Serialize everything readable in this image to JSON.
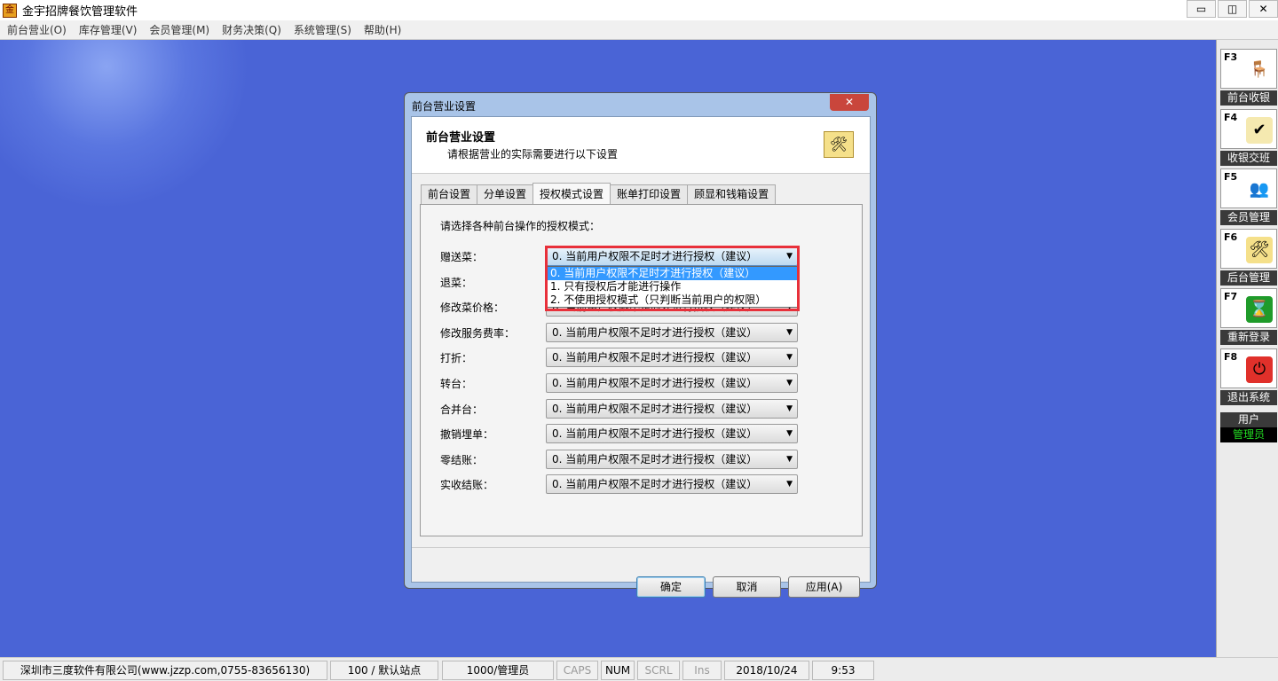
{
  "app": {
    "title": "金宇招牌餐饮管理软件",
    "icon_text": "金"
  },
  "window_controls": {
    "minimize": "▭",
    "restore": "◫",
    "close": "✕"
  },
  "menu": [
    "前台营业(O)",
    "库存管理(V)",
    "会员管理(M)",
    "财务决策(Q)",
    "系统管理(S)",
    "帮助(H)"
  ],
  "sidebar": {
    "items": [
      {
        "key": "F3",
        "label": "前台收银",
        "icon": "dining-table-icon",
        "glyph": "🪑",
        "color": "#ffffff"
      },
      {
        "key": "F4",
        "label": "收银交班",
        "icon": "clipboard-check-icon",
        "glyph": "✔",
        "color": "#f5e9b0"
      },
      {
        "key": "F5",
        "label": "会员管理",
        "icon": "users-icon",
        "glyph": "👥",
        "color": "#ffffff"
      },
      {
        "key": "F6",
        "label": "后台管理",
        "icon": "folder-tools-icon",
        "glyph": "🛠",
        "color": "#f5e08a"
      },
      {
        "key": "F7",
        "label": "重新登录",
        "icon": "hourglass-icon",
        "glyph": "⌛",
        "color": "#1f9b2a"
      },
      {
        "key": "F8",
        "label": "退出系统",
        "icon": "power-icon",
        "glyph": "⏻",
        "color": "#e0302a"
      }
    ],
    "user_label": "用户",
    "user_name": "管理员"
  },
  "dialog": {
    "title": "前台营业设置",
    "close": "✕",
    "header_title": "前台营业设置",
    "header_subtitle": "请根据营业的实际需要进行以下设置",
    "tabs": [
      "前台设置",
      "分单设置",
      "授权模式设置",
      "账单打印设置",
      "顾显和钱箱设置"
    ],
    "active_tab": 2,
    "prompt": "请选择各种前台操作的授权模式：",
    "rows": [
      {
        "label": "赠送菜：",
        "value": "0. 当前用户权限不足时才进行授权（建议）"
      },
      {
        "label": "退菜：",
        "value": "0. 当前用户权限不足时才进行授权（建议）"
      },
      {
        "label": "修改菜价格：",
        "value": "0. 当前用户权限不足时才进行授权（建议）"
      },
      {
        "label": "修改服务费率：",
        "value": "0. 当前用户权限不足时才进行授权（建议）"
      },
      {
        "label": "打折：",
        "value": "0. 当前用户权限不足时才进行授权（建议）"
      },
      {
        "label": "转台：",
        "value": "0. 当前用户权限不足时才进行授权（建议）"
      },
      {
        "label": "合并台：",
        "value": "0. 当前用户权限不足时才进行授权（建议）"
      },
      {
        "label": "撤销埋单：",
        "value": "0. 当前用户权限不足时才进行授权（建议）"
      },
      {
        "label": "零结账：",
        "value": "0. 当前用户权限不足时才进行授权（建议）"
      },
      {
        "label": "实收结账：",
        "value": "0. 当前用户权限不足时才进行授权（建议）"
      }
    ],
    "dropdown_options": [
      "0. 当前用户权限不足时才进行授权（建议）",
      "1. 只有授权后才能进行操作",
      "2. 不使用授权模式（只判断当前用户的权限）"
    ],
    "dropdown_selected": 0,
    "buttons": {
      "ok": "确定",
      "cancel": "取消",
      "apply": "应用(A)"
    }
  },
  "status": {
    "company": "深圳市三度软件有限公司(www.jzzp.com,0755-83656130)",
    "station": "100 / 默认站点",
    "user": "1000/管理员",
    "caps": "CAPS",
    "num": "NUM",
    "scrl": "SCRL",
    "ins": "Ins",
    "date": "2018/10/24",
    "time": "9:53"
  }
}
